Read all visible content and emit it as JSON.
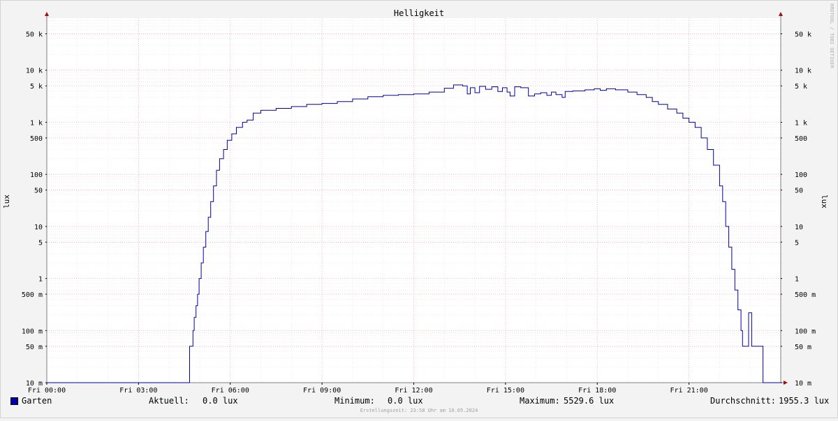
{
  "chart_data": {
    "type": "line",
    "title": "Helligkeit",
    "ylabel": "lux",
    "ylabel_right": "lux",
    "y_scale": "log",
    "ylim": [
      0.01,
      100000
    ],
    "xlim": [
      0,
      24
    ],
    "grid": true,
    "watermark": "RRDTOOL / TOBI OETIKER",
    "y_ticks": [
      {
        "value": 0.01,
        "label": "10 m"
      },
      {
        "value": 0.05,
        "label": "50 m"
      },
      {
        "value": 0.1,
        "label": "100 m"
      },
      {
        "value": 0.5,
        "label": "500 m"
      },
      {
        "value": 1,
        "label": "1"
      },
      {
        "value": 5,
        "label": "5"
      },
      {
        "value": 10,
        "label": "10"
      },
      {
        "value": 50,
        "label": "50"
      },
      {
        "value": 100,
        "label": "100"
      },
      {
        "value": 500,
        "label": "500"
      },
      {
        "value": 1000,
        "label": "1 k"
      },
      {
        "value": 5000,
        "label": "5 k"
      },
      {
        "value": 10000,
        "label": "10 k"
      },
      {
        "value": 50000,
        "label": "50 k"
      }
    ],
    "x_ticks": [
      {
        "value": 0,
        "label": "Fri 00:00"
      },
      {
        "value": 3,
        "label": "Fri 03:00"
      },
      {
        "value": 6,
        "label": "Fri 06:00"
      },
      {
        "value": 9,
        "label": "Fri 09:00"
      },
      {
        "value": 12,
        "label": "Fri 12:00"
      },
      {
        "value": 15,
        "label": "Fri 15:00"
      },
      {
        "value": 18,
        "label": "Fri 18:00"
      },
      {
        "value": 21,
        "label": "Fri 21:00"
      }
    ],
    "series": [
      {
        "name": "Garten",
        "color": "#0000aa",
        "points": [
          [
            0,
            0.01
          ],
          [
            4.65,
            0.01
          ],
          [
            4.67,
            0.05
          ],
          [
            4.75,
            0.05
          ],
          [
            4.78,
            0.1
          ],
          [
            4.82,
            0.18
          ],
          [
            4.88,
            0.3
          ],
          [
            4.93,
            0.5
          ],
          [
            4.98,
            1
          ],
          [
            5.05,
            2
          ],
          [
            5.12,
            4
          ],
          [
            5.2,
            8
          ],
          [
            5.28,
            15
          ],
          [
            5.36,
            30
          ],
          [
            5.45,
            60
          ],
          [
            5.55,
            120
          ],
          [
            5.65,
            200
          ],
          [
            5.78,
            300
          ],
          [
            5.9,
            450
          ],
          [
            6.05,
            600
          ],
          [
            6.2,
            800
          ],
          [
            6.4,
            1000
          ],
          [
            6.55,
            1100
          ],
          [
            6.75,
            1500
          ],
          [
            7.0,
            1700
          ],
          [
            7.5,
            1850
          ],
          [
            8.0,
            2000
          ],
          [
            8.5,
            2200
          ],
          [
            9.0,
            2300
          ],
          [
            9.5,
            2500
          ],
          [
            10.0,
            2800
          ],
          [
            10.5,
            3100
          ],
          [
            11.0,
            3300
          ],
          [
            11.5,
            3400
          ],
          [
            12.0,
            3500
          ],
          [
            12.5,
            3800
          ],
          [
            13.0,
            4500
          ],
          [
            13.3,
            5200
          ],
          [
            13.6,
            5000
          ],
          [
            13.75,
            3500
          ],
          [
            13.85,
            4600
          ],
          [
            14.0,
            3700
          ],
          [
            14.15,
            4900
          ],
          [
            14.35,
            4300
          ],
          [
            14.55,
            4800
          ],
          [
            14.75,
            3900
          ],
          [
            14.9,
            4600
          ],
          [
            15.05,
            3800
          ],
          [
            15.15,
            3200
          ],
          [
            15.3,
            4800
          ],
          [
            15.5,
            4600
          ],
          [
            15.75,
            3200
          ],
          [
            15.95,
            3500
          ],
          [
            16.15,
            3700
          ],
          [
            16.35,
            3300
          ],
          [
            16.5,
            3800
          ],
          [
            16.65,
            3400
          ],
          [
            16.85,
            3000
          ],
          [
            16.95,
            3900
          ],
          [
            17.2,
            4000
          ],
          [
            17.6,
            4200
          ],
          [
            17.9,
            4400
          ],
          [
            18.1,
            4100
          ],
          [
            18.3,
            4400
          ],
          [
            18.6,
            4200
          ],
          [
            19.0,
            3800
          ],
          [
            19.3,
            3400
          ],
          [
            19.6,
            3000
          ],
          [
            19.8,
            2500
          ],
          [
            20.0,
            2200
          ],
          [
            20.3,
            1800
          ],
          [
            20.6,
            1500
          ],
          [
            20.8,
            1200
          ],
          [
            21.0,
            1000
          ],
          [
            21.2,
            800
          ],
          [
            21.4,
            500
          ],
          [
            21.6,
            300
          ],
          [
            21.8,
            150
          ],
          [
            22.0,
            60
          ],
          [
            22.1,
            30
          ],
          [
            22.2,
            10
          ],
          [
            22.3,
            4
          ],
          [
            22.4,
            1.5
          ],
          [
            22.5,
            0.6
          ],
          [
            22.6,
            0.25
          ],
          [
            22.7,
            0.1
          ],
          [
            22.75,
            0.05
          ],
          [
            22.9,
            0.05
          ],
          [
            22.95,
            0.22
          ],
          [
            23.02,
            0.22
          ],
          [
            23.05,
            0.05
          ],
          [
            23.4,
            0.05
          ],
          [
            23.42,
            0.01
          ],
          [
            24,
            0.01
          ]
        ]
      }
    ]
  },
  "legend": {
    "series_name": "Garten",
    "swatch_color": "#0000aa",
    "current_label": "Aktuell:",
    "current_value": "0.0 lux",
    "min_label": "Minimum:",
    "min_value": "0.0 lux",
    "max_label": "Maximum:",
    "max_value": "5529.6 lux",
    "avg_label": "Durchschnitt:",
    "avg_value": "1955.3 lux"
  },
  "footer": "Erstellungszeit: 23:58 Uhr am 10.05.2024"
}
